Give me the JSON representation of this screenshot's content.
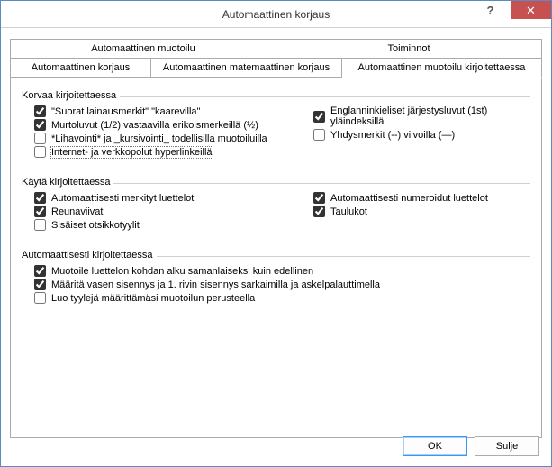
{
  "window": {
    "title": "Automaattinen korjaus",
    "help": "?",
    "close": "✕"
  },
  "tabs": {
    "row1": [
      {
        "label": "Automaattinen muotoilu"
      },
      {
        "label": "Toiminnot"
      }
    ],
    "row2": [
      {
        "label": "Automaattinen korjaus"
      },
      {
        "label": "Automaattinen matemaattinen korjaus"
      },
      {
        "label": "Automaattinen muotoilu kirjoitettaessa"
      }
    ]
  },
  "groups": {
    "replace": {
      "title": "Korvaa kirjoitettaessa",
      "items": {
        "quotes": {
          "label": "\"Suorat lainausmerkit\" \"kaarevilla\"",
          "checked": true
        },
        "ordinals": {
          "label": "Englanninkieliset järjestysluvut (1st) yläindeksillä",
          "checked": true
        },
        "fractions": {
          "label": "Murtoluvut (1/2) vastaavilla erikoismerkeillä (½)",
          "checked": true
        },
        "hyphens": {
          "label": "Yhdysmerkit (--) viivoilla (—)",
          "checked": false
        },
        "boldital": {
          "label": "*Lihavointi* ja _kursivointi_ todellisilla muotoiluilla",
          "checked": false
        },
        "internet": {
          "label": "Internet- ja verkkopolut hyperlinkeillä",
          "checked": false
        }
      }
    },
    "apply": {
      "title": "Käytä kirjoitettaessa",
      "items": {
        "bullets": {
          "label": "Automaattisesti merkityt luettelot",
          "checked": true
        },
        "numbered": {
          "label": "Automaattisesti numeroidut luettelot",
          "checked": true
        },
        "borders": {
          "label": "Reunaviivat",
          "checked": true
        },
        "tables": {
          "label": "Taulukot",
          "checked": true
        },
        "headings": {
          "label": "Sisäiset otsikkotyylit",
          "checked": false
        }
      }
    },
    "auto": {
      "title": "Automaattisesti kirjoitettaessa",
      "items": {
        "listformat": {
          "label": "Muotoile luettelon kohdan alku samanlaiseksi kuin edellinen",
          "checked": true
        },
        "indent": {
          "label": "Määritä vasen sisennys ja 1. rivin sisennys sarkaimilla ja askelpalauttimella",
          "checked": true
        },
        "styles": {
          "label": "Luo tyylejä määrittämäsi muotoilun perusteella",
          "checked": false
        }
      }
    }
  },
  "buttons": {
    "ok": "OK",
    "close": "Sulje"
  }
}
